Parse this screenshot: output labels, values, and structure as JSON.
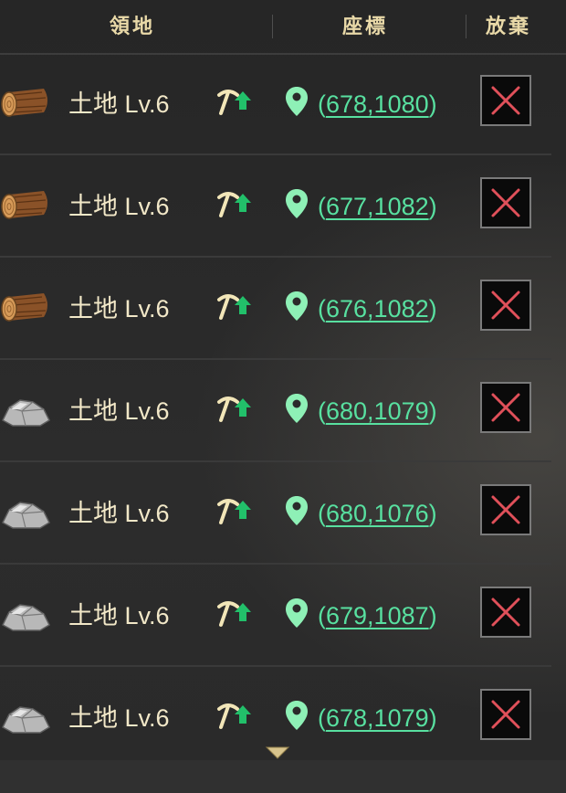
{
  "header": {
    "territory": "領地",
    "coordinates": "座標",
    "abandon": "放棄"
  },
  "rows": [
    {
      "resource": "wood-log-icon",
      "label": "土地 Lv.6",
      "coord": "678,1080"
    },
    {
      "resource": "wood-log-icon",
      "label": "土地 Lv.6",
      "coord": "677,1082"
    },
    {
      "resource": "wood-log-icon",
      "label": "土地 Lv.6",
      "coord": "676,1082"
    },
    {
      "resource": "stone-ore-icon",
      "label": "土地 Lv.6",
      "coord": "680,1079"
    },
    {
      "resource": "stone-ore-icon",
      "label": "土地 Lv.6",
      "coord": "680,1076"
    },
    {
      "resource": "stone-ore-icon",
      "label": "土地 Lv.6",
      "coord": "679,1087"
    },
    {
      "resource": "stone-ore-icon",
      "label": "土地 Lv.6",
      "coord": "678,1079"
    }
  ],
  "colors": {
    "header_text": "#e9d9a8",
    "label_text": "#f2e8c8",
    "coord_link": "#58e0a0",
    "abandon_x": "#e0505a",
    "upgrade_arrow": "#22c06a"
  },
  "icons": {
    "upgrade": "pickaxe-upgrade-icon",
    "location": "map-pin-icon",
    "abandon": "close-x-icon",
    "scroll": "chevron-down-icon"
  }
}
